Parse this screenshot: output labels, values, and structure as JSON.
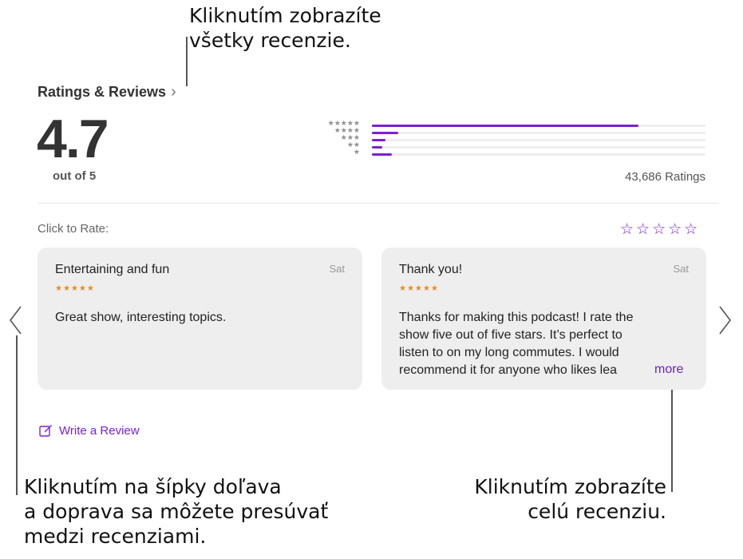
{
  "callouts": {
    "top_line1": "Kliknutím zobrazíte",
    "top_line2": "všetky recenzie.",
    "left_line1": "Kliknutím na šípky doľava",
    "left_line2": "a doprava sa môžete presúvať",
    "left_line3": "medzi recenziami.",
    "right_line1": "Kliknutím zobrazíte",
    "right_line2": "celú recenziu."
  },
  "header": {
    "title": "Ratings & Reviews",
    "chevron": "›"
  },
  "summary": {
    "rating": "4.7",
    "out_of": "out of 5",
    "count_label": "43,686 Ratings",
    "star_labels": [
      "★★★★★",
      "★★★★",
      "★★★",
      "★★",
      "★"
    ],
    "distribution": [
      0.8,
      0.08,
      0.04,
      0.03,
      0.06
    ]
  },
  "rate": {
    "label": "Click to Rate:",
    "stars": "☆☆☆☆☆"
  },
  "reviews": [
    {
      "title": "Entertaining and fun",
      "date": "Sat",
      "stars": "★★★★★",
      "body": "Great show, interesting topics."
    },
    {
      "title": "Thank you!",
      "date": "Sat",
      "stars": "★★★★★",
      "body_lines": [
        "Thanks for making this podcast! I rate the",
        "show five out of five stars. It’s perfect to",
        "listen to on my long commutes. I would",
        "recommend it for anyone who likes lea"
      ],
      "more": "more"
    }
  ],
  "nav": {
    "prev": "〈",
    "next": "〉"
  },
  "write_review": {
    "label": "Write a Review",
    "icon": "compose-icon"
  },
  "colors": {
    "accent": "#7a1fd6",
    "card_bg": "#eeeeee",
    "star_orange": "#f28a1e"
  }
}
